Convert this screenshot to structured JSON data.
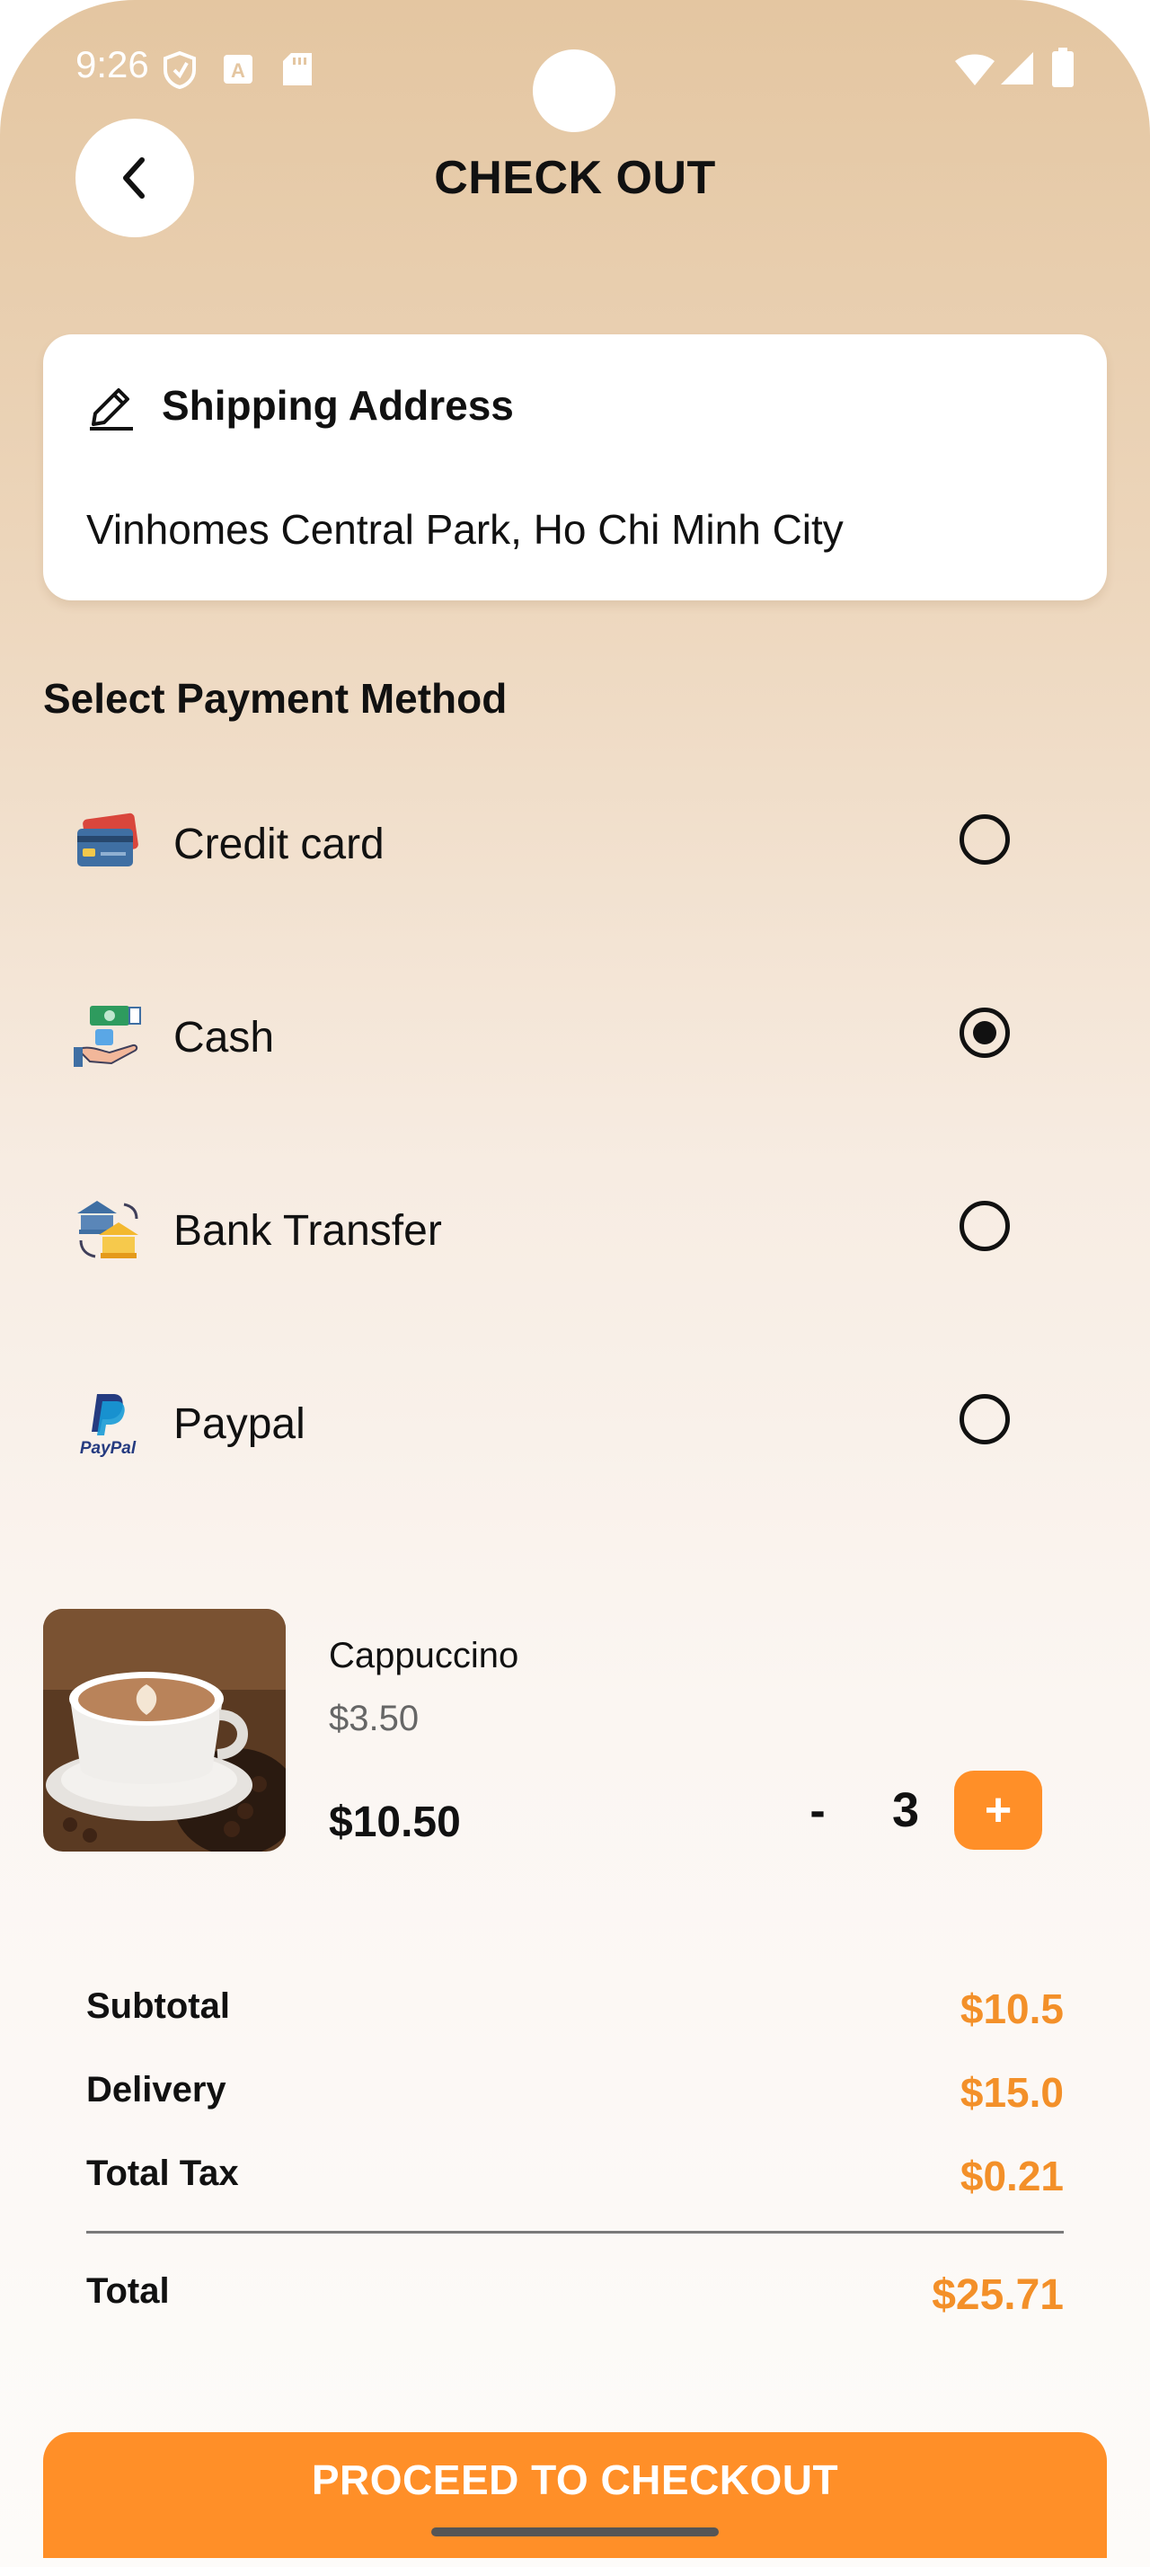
{
  "status_bar": {
    "time": "9:26",
    "icons": [
      "shield-icon",
      "translate-icon",
      "sd-card-icon",
      "wifi-icon",
      "signal-icon",
      "battery-icon"
    ]
  },
  "header": {
    "title": "CHECK OUT",
    "back_icon": "chevron-left-icon"
  },
  "shipping": {
    "title": "Shipping Address",
    "address": "Vinhomes Central Park, Ho Chi Minh City",
    "icon": "pencil-icon"
  },
  "payment": {
    "title": "Select Payment Method",
    "methods": [
      {
        "label": "Credit card",
        "icon": "credit-card-icon",
        "selected": false
      },
      {
        "label": "Cash",
        "icon": "cash-icon",
        "selected": true
      },
      {
        "label": "Bank Transfer",
        "icon": "bank-transfer-icon",
        "selected": false
      },
      {
        "label": "Paypal",
        "icon": "paypal-icon",
        "selected": false
      }
    ]
  },
  "cart_item": {
    "name": "Cappuccino",
    "unit_price": "$3.50",
    "line_total": "$10.50",
    "quantity": "3",
    "minus_label": "-",
    "plus_label": "+"
  },
  "summary": {
    "subtotal_label": "Subtotal",
    "subtotal_value": "$10.5",
    "delivery_label": "Delivery",
    "delivery_value": "$15.0",
    "tax_label": "Total Tax",
    "tax_value": "$0.21",
    "total_label": "Total",
    "total_value": "$25.71"
  },
  "checkout_button": "PROCEED TO CHECKOUT",
  "colors": {
    "accent": "#ff8f28",
    "price": "#f39029"
  }
}
